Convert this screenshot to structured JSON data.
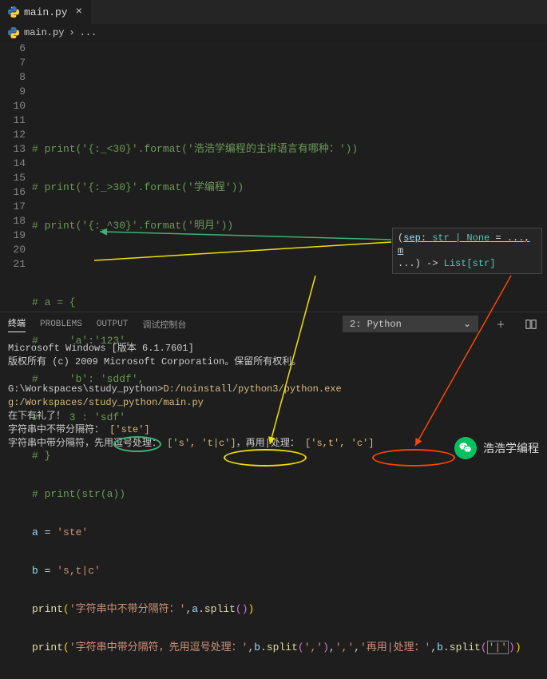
{
  "tab": {
    "filename": "main.py"
  },
  "breadcrumb": {
    "filename": "main.py",
    "sep": "›",
    "rest": "..."
  },
  "gutter": [
    "6",
    "7",
    "8",
    "9",
    "10",
    "11",
    "12",
    "13",
    "14",
    "15",
    "16",
    "17",
    "18",
    "19",
    "20",
    "21"
  ],
  "code": {
    "l8": "# print('{:_<30}'.format('浩浩学编程的主讲语言有哪种：'))",
    "l9": "# print('{:_>30}'.format('学编程'))",
    "l10": "# print('{:_^30}'.format('明月'))",
    "l12": "# a = {",
    "l13": "#     'a':'123',",
    "l14": "#     'b': 'sddf',",
    "l15": "#     3 : 'sdf'",
    "l16": "# }",
    "l17": "# print(str(a))",
    "l18_a": "a",
    "l18_eq": " = ",
    "l18_str": "'ste'",
    "l19_a": "b",
    "l19_eq": " = ",
    "l19_str": "'s,t|c'",
    "l20_print": "print",
    "l20_str1": "'字符串中不带分隔符：'",
    "l20_comma": ",",
    "l20_a": "a",
    "l20_dot": ".",
    "l20_split": "split",
    "l21_print": "print",
    "l21_str1": "'字符串中带分隔符，先用逗号处理：'",
    "l21_b1": "b",
    "l21_split": "split",
    "l21_arg1": "','",
    "l21_str2": "','",
    "l21_str3": "'再用|处理：'",
    "l21_b2": "b",
    "l21_arg2": "'|'"
  },
  "hint": {
    "line1_sep": "sep",
    "line1_colon": ": ",
    "line1_type": "str | None",
    "line1_rest": " = ..., m",
    "line2_dots": "...",
    "line2_arrow": ") -> ",
    "line2_ret": "List[str]"
  },
  "panel": {
    "tabs": {
      "terminal": "终端",
      "problems": "PROBLEMS",
      "output": "OUTPUT",
      "debug": "调试控制台"
    },
    "dropdown": "2: Python"
  },
  "terminal": {
    "line1": "Microsoft Windows [版本 6.1.7601]",
    "line2": "版权所有 (c) 2009 Microsoft Corporation。保留所有权利。",
    "prompt": "G:\\Workspaces\\study_python>",
    "cmd": "D:/noinstall/python3/python.exe g:/Workspaces/study_python/main.py",
    "out1": "在下有礼了！",
    "out2_label": "字符串中不带分隔符：",
    "out2_val": " ['ste']",
    "out3_label1": "字符串中带分隔符，先用逗号处理：",
    "out3_val1": " ['s', 't|c']",
    "out3_label2": "，再用|处理：",
    "out3_val2": " ['s,t', 'c']"
  },
  "watermark": "浩浩学编程"
}
